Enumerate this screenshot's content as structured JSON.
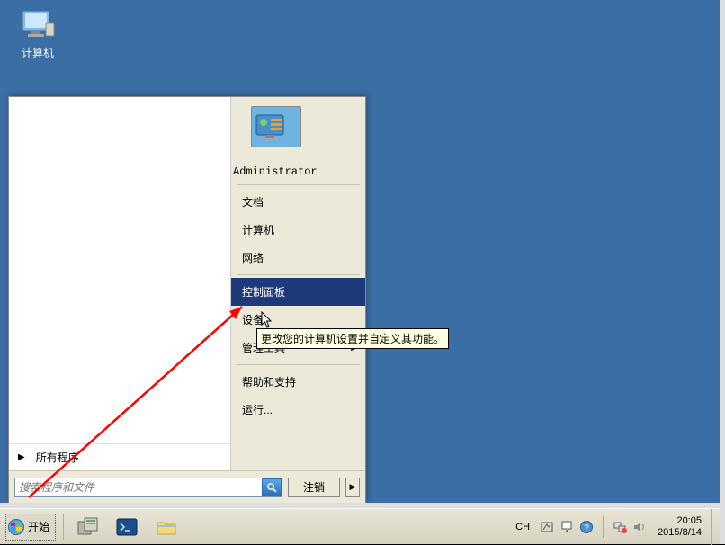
{
  "desktop": {
    "icons": [
      {
        "label": "计算机",
        "name": "computer"
      }
    ]
  },
  "start_menu": {
    "user": {
      "name": "Administrator"
    },
    "items": [
      {
        "label": "文档",
        "name": "documents",
        "submenu": false,
        "selected": false
      },
      {
        "label": "计算机",
        "name": "computer",
        "submenu": false,
        "selected": false
      },
      {
        "label": "网络",
        "name": "network",
        "submenu": false,
        "sep_after": true,
        "selected": false
      },
      {
        "label": "控制面板",
        "name": "control-panel",
        "submenu": false,
        "selected": true
      },
      {
        "label": "设备和打印机",
        "name": "devices-printers",
        "submenu": false,
        "truncated_label": "设备",
        "selected": false
      },
      {
        "label": "管理工具",
        "name": "admin-tools",
        "submenu": true,
        "sep_after": true,
        "selected": false
      },
      {
        "label": "帮助和支持",
        "name": "help-support",
        "submenu": false,
        "selected": false
      },
      {
        "label": "运行...",
        "name": "run",
        "submenu": false,
        "selected": false
      }
    ],
    "all_programs": "所有程序",
    "search_placeholder": "搜索程序和文件",
    "logoff": "注销",
    "tooltip": "更改您的计算机设置并自定义其功能。"
  },
  "taskbar": {
    "start": "开始",
    "lang": "CH",
    "clock_time": "20:05",
    "clock_date": "2015/8/14"
  }
}
